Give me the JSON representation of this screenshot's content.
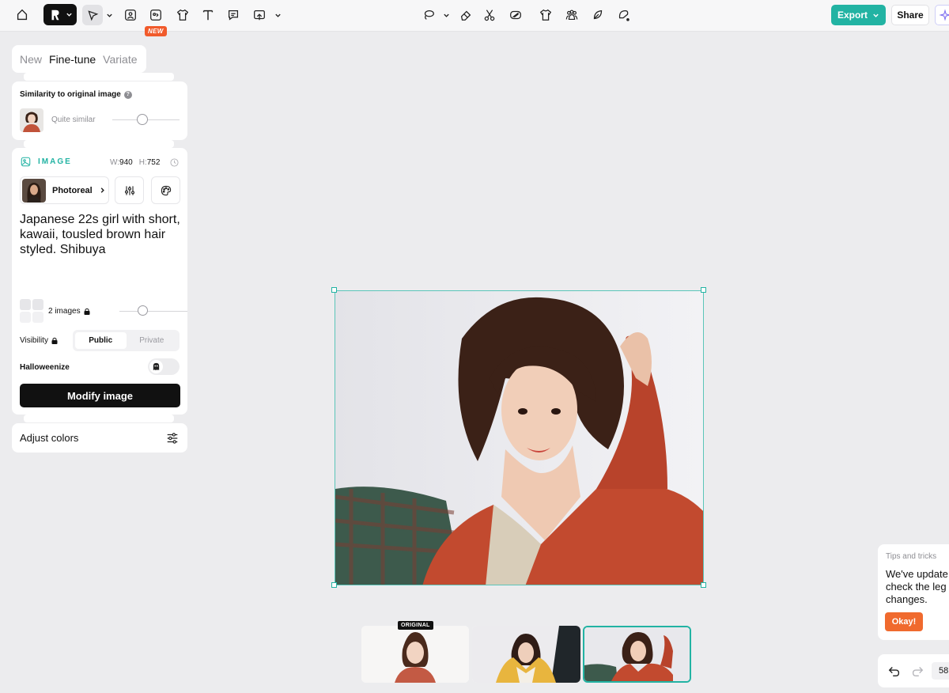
{
  "toolbar": {
    "new_badge": "NEW",
    "export_label": "Export",
    "share_label": "Share"
  },
  "panel": {
    "tabs": [
      {
        "label": "New",
        "active": false
      },
      {
        "label": "Fine-tune",
        "active": true
      },
      {
        "label": "Variate",
        "active": false
      }
    ],
    "similarity": {
      "title": "Similarity to original image",
      "value_label": "Quite similar",
      "level": 0.45
    },
    "image": {
      "heading": "IMAGE",
      "width_label": "W:",
      "width_value": "940",
      "height_label": "H:",
      "height_value": "752",
      "style_label": "Photoreal",
      "prompt": "Japanese 22s girl with short, kawaii, tousled brown hair styled. Shibuya",
      "count_label": "2 images",
      "count_level": 0.35,
      "visibility_label": "Visibility",
      "visibility_options": [
        "Public",
        "Private"
      ],
      "visibility_selected": "Public",
      "halloweenize_label": "Halloweenize",
      "halloweenize_on": false,
      "modify_label": "Modify image"
    },
    "adjust_colors_label": "Adjust colors"
  },
  "thumbnails": {
    "original_badge": "ORIGINAL",
    "selected_index": 2
  },
  "tips": {
    "title": "Tips and tricks",
    "line1": "We've update",
    "line2": "check the leg",
    "line3": "changes.",
    "button": "Okay!"
  },
  "history": {
    "zoom": "58"
  },
  "colors": {
    "accent": "#22b3a3",
    "badge": "#f15a2b",
    "okay": "#f06a2e"
  }
}
